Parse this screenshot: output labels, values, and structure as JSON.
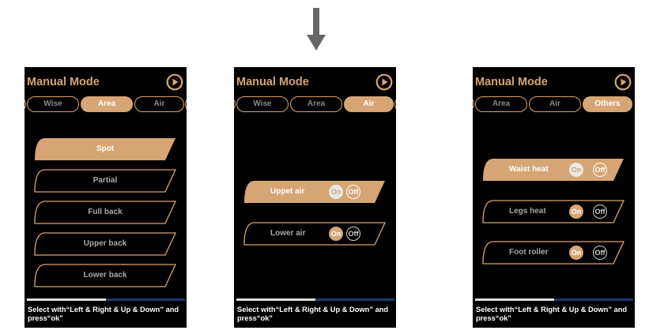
{
  "colors": {
    "accent": "#d6a574",
    "panel": "#000000",
    "progress_track": "#1a3a6a",
    "progress_fill": "#dcdcdc"
  },
  "screens": [
    {
      "title": "Manual Mode",
      "tabs": [
        "",
        "Wise",
        "Area",
        "Air",
        ""
      ],
      "active_tab": "Area",
      "items": [
        "Spot",
        "Partial",
        "Full back",
        "Upper back",
        "Lower back"
      ],
      "active_item": "Spot",
      "progress_fraction": 0.5,
      "hint": "Select with“Left & Right & Up & Down” and press“ok”"
    },
    {
      "title": "Manual Mode",
      "tabs": [
        "",
        "Wise",
        "Area",
        "Air",
        ""
      ],
      "active_tab": "Air",
      "items": [
        {
          "label": "Uppet air",
          "on": "On",
          "off": "Off"
        },
        {
          "label": "Lower air",
          "on": "On",
          "off": "Off"
        }
      ],
      "active_item": "Uppet air",
      "progress_fraction": 0.5,
      "hint": "Select with“Left & Right & Up & Down” and press“ok”"
    },
    {
      "title": "Manual Mode",
      "tabs": [
        "",
        "Area",
        "Air",
        "Others",
        ""
      ],
      "active_tab": "Others",
      "items": [
        {
          "label": "Waist heat",
          "on": "On",
          "off": "Off"
        },
        {
          "label": "Legs heat",
          "on": "On",
          "off": "Off"
        },
        {
          "label": "Foot roller",
          "on": "On",
          "off": "Off"
        }
      ],
      "active_item": "Waist heat",
      "progress_fraction": 0.5,
      "hint": "Select with“Left & Right & Up & Down” and press“ok”"
    }
  ],
  "icons": {
    "transition": "down-arrow-icon",
    "play": "play-circle-icon"
  }
}
